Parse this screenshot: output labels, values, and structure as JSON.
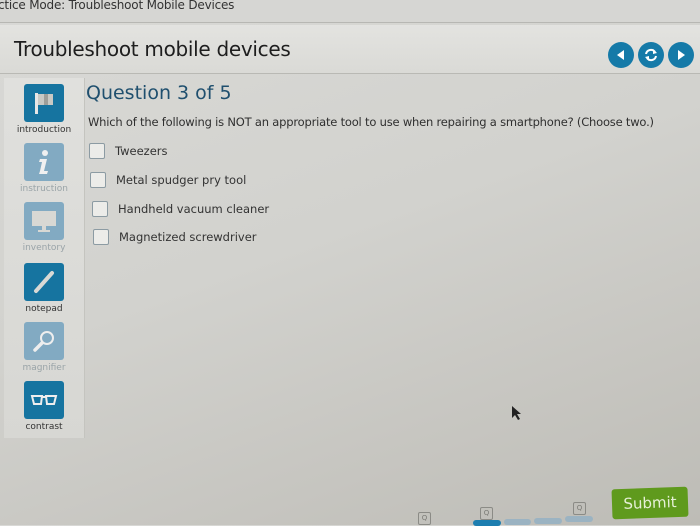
{
  "window": {
    "title": "ctice Mode: Troubleshoot Mobile Devices"
  },
  "header": {
    "title": "Troubleshoot mobile devices",
    "nav": [
      {
        "name": "previous-button",
        "icon": "chevron-left-icon"
      },
      {
        "name": "reset-button",
        "icon": "refresh-icon"
      },
      {
        "name": "next-button",
        "icon": "chevron-right-icon"
      }
    ]
  },
  "sidebar": {
    "items": [
      {
        "label": "introduction",
        "icon": "flag-icon",
        "state": "active"
      },
      {
        "label": "instruction",
        "icon": "info-icon",
        "state": "dim"
      },
      {
        "label": "inventory",
        "icon": "monitor-icon",
        "state": "dim"
      },
      {
        "label": "notepad",
        "icon": "pencil-icon",
        "state": "active"
      },
      {
        "label": "magnifier",
        "icon": "magnifier-icon",
        "state": "dim"
      },
      {
        "label": "contrast",
        "icon": "glasses-icon",
        "state": "active"
      }
    ]
  },
  "question": {
    "number_label": "Question 3 of 5",
    "text": "Which of the following is NOT an appropriate tool to use when repairing a smartphone? (Choose two.)",
    "options": [
      {
        "label": "Tweezers",
        "checked": false
      },
      {
        "label": "Metal spudger pry tool",
        "checked": false
      },
      {
        "label": "Handheld vacuum cleaner",
        "checked": false
      },
      {
        "label": "Magnetized screwdriver",
        "checked": false
      }
    ]
  },
  "footer": {
    "question_icon_glyph": "Q",
    "progress": {
      "current": 3,
      "total": 5
    },
    "submit_label": "Submit"
  },
  "colors": {
    "accent_blue": "#157aa8",
    "submit_green": "#5f9a1d",
    "question_heading": "#1f4f6e"
  }
}
